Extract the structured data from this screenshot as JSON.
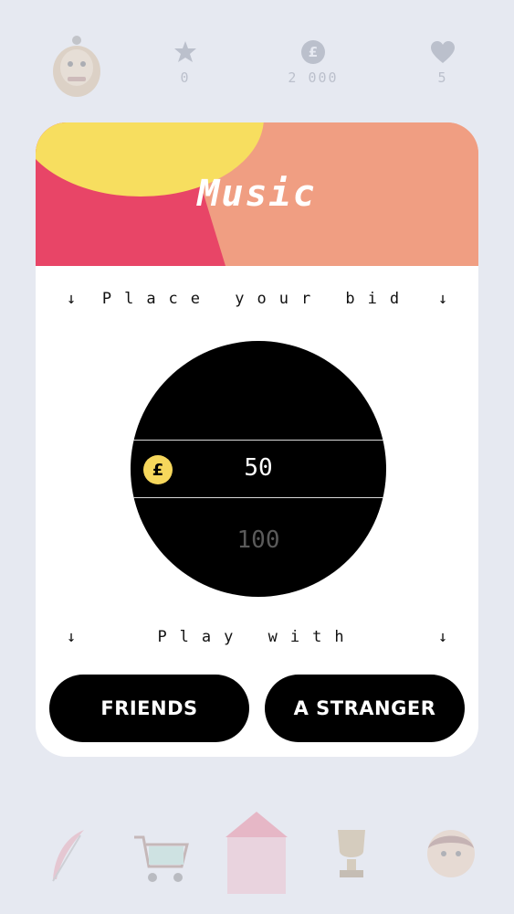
{
  "colors": {
    "background": "#e6e9f1",
    "card": "#ffffff",
    "banner_red": "#e84567",
    "banner_peach": "#f09e82",
    "banner_yellow": "#f7de5f",
    "coin": "#f6d75c",
    "button": "#000000"
  },
  "stats": {
    "stars": "0",
    "coins": "2 000",
    "lives": "5"
  },
  "category": {
    "title": "Music"
  },
  "bid": {
    "label": "Place your bid",
    "selected": "50",
    "next": "100",
    "coin_symbol": "£"
  },
  "play": {
    "label": "Play with",
    "friends_label": "FRIENDS",
    "stranger_label": "A STRANGER"
  },
  "arrow_glyph": "↓",
  "icons": {
    "top": [
      "avatar-icon",
      "star-icon",
      "coin-icon",
      "heart-icon"
    ],
    "nav": [
      "feather-icon",
      "shopping-cart-icon",
      "home-icon",
      "trophy-icon",
      "profile-icon"
    ]
  }
}
